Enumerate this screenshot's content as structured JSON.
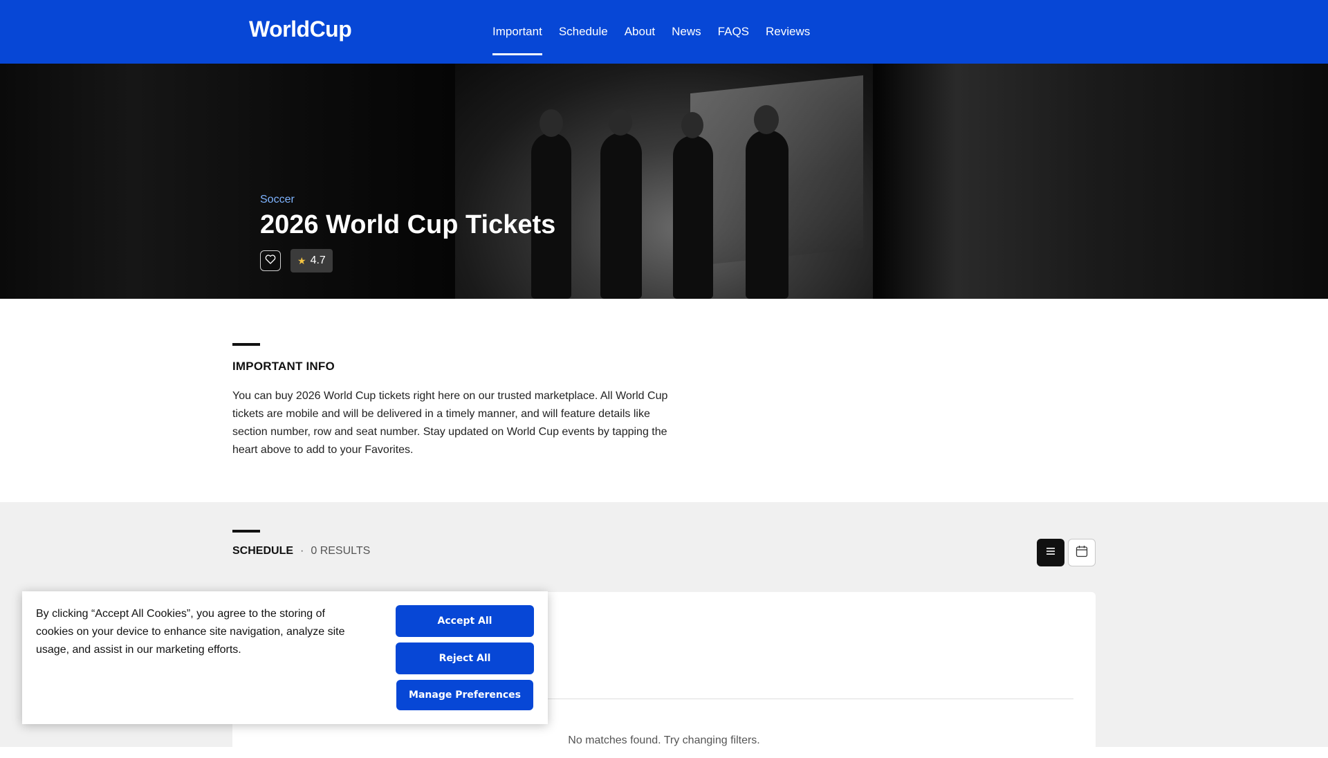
{
  "header": {
    "logo": "WorldCup",
    "nav": [
      {
        "label": "Important",
        "active": true
      },
      {
        "label": "Schedule"
      },
      {
        "label": "About"
      },
      {
        "label": "News"
      },
      {
        "label": "FAQS"
      },
      {
        "label": "Reviews"
      }
    ],
    "background_color": "#0747d6"
  },
  "hero": {
    "category": "Soccer",
    "title": "2026 World Cup Tickets",
    "favorite_icon": "heart-icon",
    "rating": "4.7",
    "rating_icon": "star-icon"
  },
  "important": {
    "heading": "IMPORTANT INFO",
    "body": "You can buy 2026 World Cup tickets right here on our trusted marketplace. All World Cup tickets are mobile and will be delivered in a timely manner, and will feature details like section number, row and seat number. Stay updated on World Cup events by tapping the heart above to add to your Favorites."
  },
  "schedule": {
    "heading": "SCHEDULE",
    "separator": "·",
    "count": "0 RESULTS",
    "list_view_icon": "list-icon",
    "calendar_view_icon": "calendar-icon",
    "empty_message": "No matches found. Try changing filters."
  },
  "cookie_banner": {
    "text": "By clicking “Accept All Cookies”, you agree to the storing of cookies on your device to enhance site navigation, analyze site usage, and assist in our marketing efforts.",
    "accept_all": "Accept All",
    "reject_all": "Reject All",
    "manage": "Manage Preferences"
  }
}
